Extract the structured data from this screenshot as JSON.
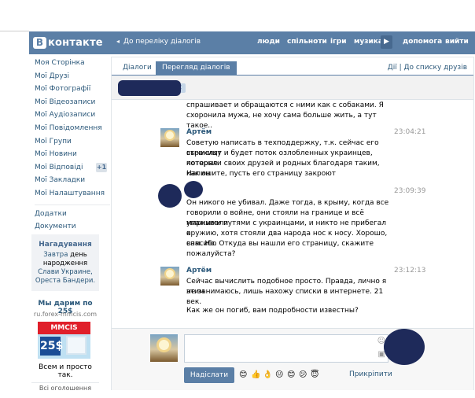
{
  "header": {
    "logo": "контакте",
    "logo_mark": "В",
    "back_link": "До переліку діалогів",
    "nav": [
      "люди",
      "спільноти",
      "ігри",
      "музика",
      "допомога",
      "вийти"
    ],
    "play_icon": "play-icon",
    "bg_color": "#5b7fa6"
  },
  "sidebar": {
    "items": [
      {
        "label": "Моя Сторінка"
      },
      {
        "label": "Мої Друзі"
      },
      {
        "label": "Мої Фотографії"
      },
      {
        "label": "Мої Відеозаписи"
      },
      {
        "label": "Мої Аудіозаписи"
      },
      {
        "label": "Мої Повідомлення"
      },
      {
        "label": "Мої Групи"
      },
      {
        "label": "Мої Новини"
      },
      {
        "label": "Мої Відповіді",
        "badge": "+1"
      },
      {
        "label": "Мої Закладки"
      },
      {
        "label": "Мої Налаштування"
      }
    ],
    "extra": [
      "Додатки",
      "Документи"
    ]
  },
  "reminder": {
    "title": "Нагадування",
    "line1_link": "Завтра",
    "line1_rest": "день",
    "line2": "народження",
    "line3": "Слави Украине,",
    "line4": "Ореста Бандери."
  },
  "ad": {
    "title": "Мы дарим по 25$",
    "url": "ru.forex-mmcis.com",
    "brand": "MMCIS",
    "amount": "25$",
    "text": "Всем и просто так.",
    "all_ads": "Всі оголошення"
  },
  "tabs": {
    "dialogs": "Діалоги",
    "view": "Перегляд діалогів",
    "right": "Дії  |  До списку друзів"
  },
  "messages": {
    "top_line1": "спрашивает и обращаются с ними как с собаками. Я",
    "top_line2": "схоронила мужа, не хочу сама больше жить, а тут такое..",
    "m1_author": "Артём",
    "m1_time": "23:04:21",
    "m1_l1": "Советую написать в техподдержку, т.к. сейчас его страницу",
    "m1_l2": "вычислят и будет поток озлобленных украинцев, которые",
    "m1_l3": "потеряли своих друзей и родных благодаря таким, как он",
    "m1_l4": "Напишите, пусть его страницу закроют",
    "m2_time": "23:09:39",
    "m2_l1": "Он никого не убивал. Даже тогда, в крыму, когда все",
    "m2_l2": "говорили о войне, они стояли на границе и всё упаживали",
    "m2_l3": "мирными путями с украинцами, и никто не прибегал к",
    "m2_l4": "оружию, хотя стояли два народа нос к носу. Хорошо, спасибо",
    "m2_l5": "вам. Но. Откуда вы нашли его страницу, скажите",
    "m2_l6": "пожалуйста?",
    "m3_author": "Артём",
    "m3_time": "23:12:13",
    "m3_l1": "Сейчас вычислить подобное просто. Правда, лично я этим",
    "m3_l2": "не занимаюсь, лишь нахожу списки в интернете. 21 век.",
    "m3_l3": "Как же он погиб, вам подробности известны?"
  },
  "compose": {
    "send": "Надіслати",
    "attach": "Прикріпити",
    "emoji": [
      "😊",
      "👍",
      "👌",
      "😐",
      "😊",
      "😕",
      "😇"
    ]
  }
}
